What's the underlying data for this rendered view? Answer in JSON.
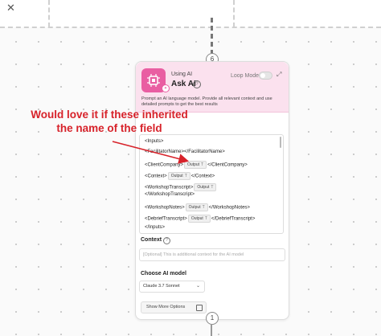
{
  "canvas": {
    "top_step_number": "6",
    "bottom_step_number": "1"
  },
  "node": {
    "using_label": "Using AI",
    "title": "Ask AI",
    "loop_mode_label": "Loop Mode",
    "loop_mode_on": false,
    "description": "Prompt an AI language model. Provide all relevant context and use detailed prompts to get the best results",
    "prompt": {
      "lines": [
        {
          "before": "<Inputs>",
          "chip": "",
          "after": ""
        },
        {
          "before": "<FacilitatorName></FacilitatorName>",
          "chip": "",
          "after": ""
        },
        {
          "before": "<ClientCompany>",
          "chip": "Output",
          "after": "</ClientCompany>"
        },
        {
          "before": "<Context>",
          "chip": "Output",
          "after": "</Context>"
        },
        {
          "before": "<WorkshopTranscript>",
          "chip": "Output",
          "after": ""
        },
        {
          "before": "</WorkshopTranscript>",
          "chip": "",
          "after": ""
        },
        {
          "before": "<WorkshopNotes>",
          "chip": "Output",
          "after": "</WorkshopNotes>"
        },
        {
          "before": "<DebriefTranscript>",
          "chip": "Output",
          "after": "</DebriefTranscript>"
        },
        {
          "before": "</Inputs>",
          "chip": "",
          "after": ""
        }
      ],
      "chip_type_glyph": "T"
    },
    "context_label": "Context",
    "context_placeholder": "[Optional] This is additional context for the AI model",
    "model_label": "Choose AI model",
    "model_value": "Claude 3.7 Sonnet",
    "show_more_label": "Show More Options"
  },
  "annotation": {
    "text_line1": "Would love it if these inherited",
    "text_line2": "the name of the field",
    "color": "#d7222a"
  },
  "colors": {
    "header_bg": "#fbe1ee",
    "icon_bg": "#e95ea2"
  }
}
